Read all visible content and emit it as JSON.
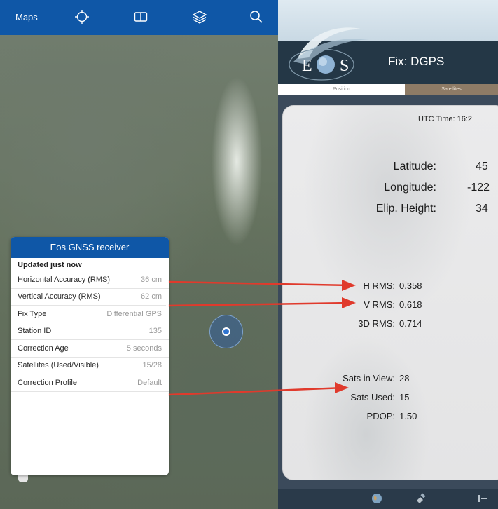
{
  "maps_app": {
    "title": "Maps",
    "toolbar_icons": [
      "location-icon",
      "map-book-icon",
      "layers-icon",
      "search-icon"
    ]
  },
  "gnss_panel": {
    "title": "Eos GNSS receiver",
    "updated": "Updated just now",
    "rows": [
      {
        "label": "Horizontal Accuracy (RMS)",
        "value": "36 cm"
      },
      {
        "label": "Vertical Accuracy (RMS)",
        "value": "62 cm"
      },
      {
        "label": "Fix Type",
        "value": "Differential GPS"
      },
      {
        "label": "Station ID",
        "value": "135"
      },
      {
        "label": "Correction Age",
        "value": "5 seconds"
      },
      {
        "label": "Satellites (Used/Visible)",
        "value": "15/28"
      },
      {
        "label": "Correction Profile",
        "value": "Default"
      }
    ]
  },
  "eos_app": {
    "logo_text_left": "E",
    "logo_text_right": "S",
    "fix": "Fix: DGPS",
    "tabs": [
      "Position",
      "Satellites"
    ],
    "utc_time": "UTC Time: 16:2",
    "position": [
      {
        "label": "Latitude:",
        "value": "45"
      },
      {
        "label": "Longitude:",
        "value": "-122"
      },
      {
        "label": "Elip. Height:",
        "value": "34"
      }
    ],
    "rms": [
      {
        "label": "H RMS:",
        "value": "0.358"
      },
      {
        "label": "V RMS:",
        "value": "0.618"
      },
      {
        "label": "3D RMS:",
        "value": "0.714"
      }
    ],
    "sats": [
      {
        "label": "Sats in View:",
        "value": "28"
      },
      {
        "label": "Sats Used:",
        "value": "15"
      },
      {
        "label": "PDOP:",
        "value": "1.50"
      }
    ],
    "bottom_icons": [
      "globe-icon",
      "satellite-icon",
      "more-icon"
    ]
  },
  "colors": {
    "maps_bar": "#0f57a7",
    "eos_header": "#243746",
    "satellites_tab": "#8e7b66",
    "arrow": "#e03a2c"
  }
}
